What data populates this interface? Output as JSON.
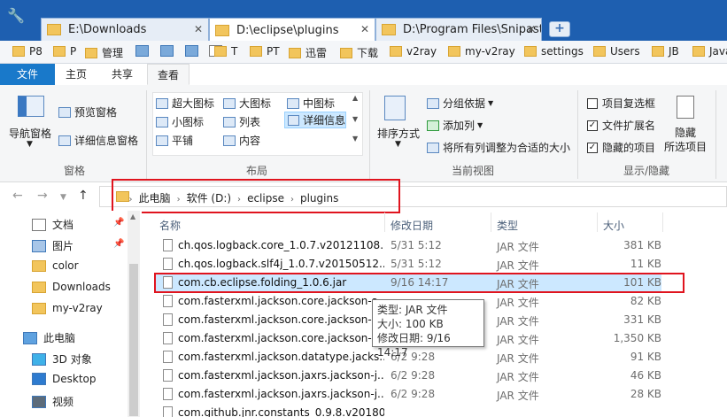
{
  "tabs": [
    {
      "label": "E:\\Downloads",
      "active": false
    },
    {
      "label": "D:\\eclipse\\plugins",
      "active": true
    },
    {
      "label": "D:\\Program Files\\Snipast",
      "active": false
    }
  ],
  "new_tab": "+",
  "bookmarks": [
    "P8",
    "P",
    "管理",
    "",
    "",
    "",
    "",
    "T",
    "PT",
    "迅雷",
    "下载",
    "v2ray",
    "my-v2ray",
    "settings",
    "Users",
    "JB",
    "Java"
  ],
  "ribbon_tabs": [
    "文件",
    "主页",
    "共享",
    "查看"
  ],
  "panes_group": {
    "nav_pane": "导航窗格",
    "preview_pane": "预览窗格",
    "details_pane": "详细信息窗格",
    "name": "窗格"
  },
  "layout_group": {
    "items": [
      "超大图标",
      "大图标",
      "中图标",
      "小图标",
      "列表",
      "详细信息",
      "平铺",
      "内容"
    ],
    "name": "布局"
  },
  "current_view_group": {
    "sort_by": "排序方式",
    "group_by": "分组依据",
    "add_column": "添加列",
    "fit_columns": "将所有列调整为合适的大小",
    "name": "当前视图"
  },
  "show_hide_group": {
    "item_checkboxes": "项目复选框",
    "file_extensions": "文件扩展名",
    "hidden_items": "隐藏的项目",
    "hide_selected": "隐藏",
    "hide_selected_2": "所选项目",
    "name": "显示/隐藏",
    "checks": {
      "item_checkboxes": false,
      "file_extensions": true,
      "hidden_items": true
    }
  },
  "breadcrumb": [
    "此电脑",
    "软件 (D:)",
    "eclipse",
    "plugins"
  ],
  "nav_tree": [
    {
      "label": "文档",
      "kind": "doc",
      "pinned": true
    },
    {
      "label": "图片",
      "kind": "pic",
      "pinned": true
    },
    {
      "label": "color",
      "kind": "folder"
    },
    {
      "label": "Downloads",
      "kind": "folder"
    },
    {
      "label": "my-v2ray",
      "kind": "folder"
    },
    {
      "label": "此电脑",
      "kind": "pc"
    },
    {
      "label": "3D 对象",
      "kind": "3d"
    },
    {
      "label": "Desktop",
      "kind": "desktop"
    },
    {
      "label": "视频",
      "kind": "video"
    }
  ],
  "columns": [
    "名称",
    "修改日期",
    "类型",
    "大小"
  ],
  "files": [
    {
      "name": "ch.qos.logback.core_1.0.7.v20121108...",
      "date": "5/31 5:12",
      "type": "JAR 文件",
      "size": "381 KB"
    },
    {
      "name": "ch.qos.logback.slf4j_1.0.7.v20150512...",
      "date": "5/31 5:12",
      "type": "JAR 文件",
      "size": "11 KB"
    },
    {
      "name": "com.cb.eclipse.folding_1.0.6.jar",
      "date": "9/16 14:17",
      "type": "JAR 文件",
      "size": "101 KB",
      "selected": true
    },
    {
      "name": "com.fasterxml.jackson.core.jackson-a...",
      "date": "",
      "type": "JAR 文件",
      "size": "82 KB"
    },
    {
      "name": "com.fasterxml.jackson.core.jackson-c...",
      "date": "",
      "type": "JAR 文件",
      "size": "331 KB"
    },
    {
      "name": "com.fasterxml.jackson.core.jackson-d...",
      "date": "",
      "type": "JAR 文件",
      "size": "1,350 KB"
    },
    {
      "name": "com.fasterxml.jackson.datatype.jacks...",
      "date": "6/2 9:28",
      "type": "JAR 文件",
      "size": "91 KB"
    },
    {
      "name": "com.fasterxml.jackson.jaxrs.jackson-j...",
      "date": "6/2 9:28",
      "type": "JAR 文件",
      "size": "46 KB"
    },
    {
      "name": "com.fasterxml.jackson.jaxrs.jackson-j...",
      "date": "6/2 9:28",
      "type": "JAR 文件",
      "size": "28 KB"
    },
    {
      "name": "com.github.jnr.constants_0.9.8.v20180...",
      "date": "",
      "type": "",
      "size": ""
    }
  ],
  "tooltip": {
    "type": "类型: JAR 文件",
    "size": "大小: 100 KB",
    "modified": "修改日期: 9/16 14:17"
  },
  "colors": {
    "titlebar": "#1e5fb0",
    "file_tab": "#1979ca",
    "selected_row": "#cce8ff",
    "highlight_box": "#e0141e"
  }
}
